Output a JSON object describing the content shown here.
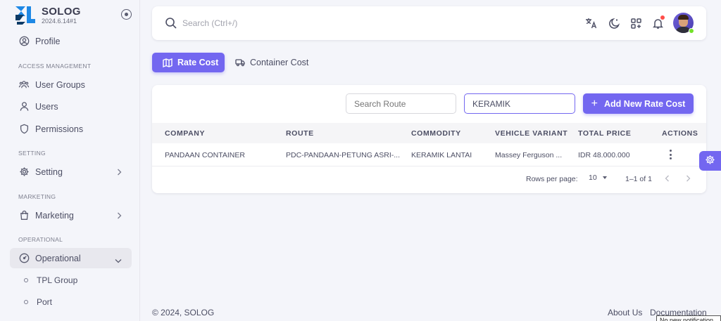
{
  "brand": {
    "name": "SOLOG",
    "version": "2024.6.14#1",
    "colors": {
      "logo_primary": "#1e88e5",
      "logo_dark": "#0d3b66"
    }
  },
  "sidebar": {
    "profile": "Profile",
    "sections": {
      "access": "ACCESS MANAGEMENT",
      "setting": "SETTING",
      "marketing": "MARKETING",
      "operational": "OPERATIONAL"
    },
    "items": {
      "user_groups": "User Groups",
      "users": "Users",
      "permissions": "Permissions",
      "setting": "Setting",
      "marketing": "Marketing",
      "operational": "Operational",
      "tpl_group": "TPL Group",
      "port": "Port"
    }
  },
  "topbar": {
    "search_placeholder": "Search (Ctrl+/)"
  },
  "tabs": {
    "rate_cost": "Rate Cost",
    "container_cost": "Container Cost"
  },
  "filters": {
    "route_placeholder": "Search Route",
    "commodity_value": "KERAMIK",
    "add_button": "Add New Rate Cost"
  },
  "table": {
    "headers": {
      "company": "COMPANY",
      "route": "ROUTE",
      "commodity": "COMMODITY",
      "vehicle": "VEHICLE VARIANT",
      "price": "TOTAL PRICE",
      "actions": "ACTIONS"
    },
    "rows": [
      {
        "company": "PANDAAN CONTAINER",
        "route": "PDC-PANDAAN-PETUNG ASRI-...",
        "commodity": "KERAMIK LANTAI",
        "vehicle": "Massey Ferguson ...",
        "price": "IDR 48.000.000"
      }
    ]
  },
  "pagination": {
    "rows_label": "Rows per page:",
    "rows_value": "10",
    "range": "1–1 of 1"
  },
  "footer": {
    "copyright": "© 2024, SOLOG",
    "about": "About Us",
    "docs": "Documentation",
    "tooltip": "No new notification"
  },
  "colors": {
    "accent": "#7367f0",
    "notification": "#ff4d49",
    "online": "#72e128"
  }
}
